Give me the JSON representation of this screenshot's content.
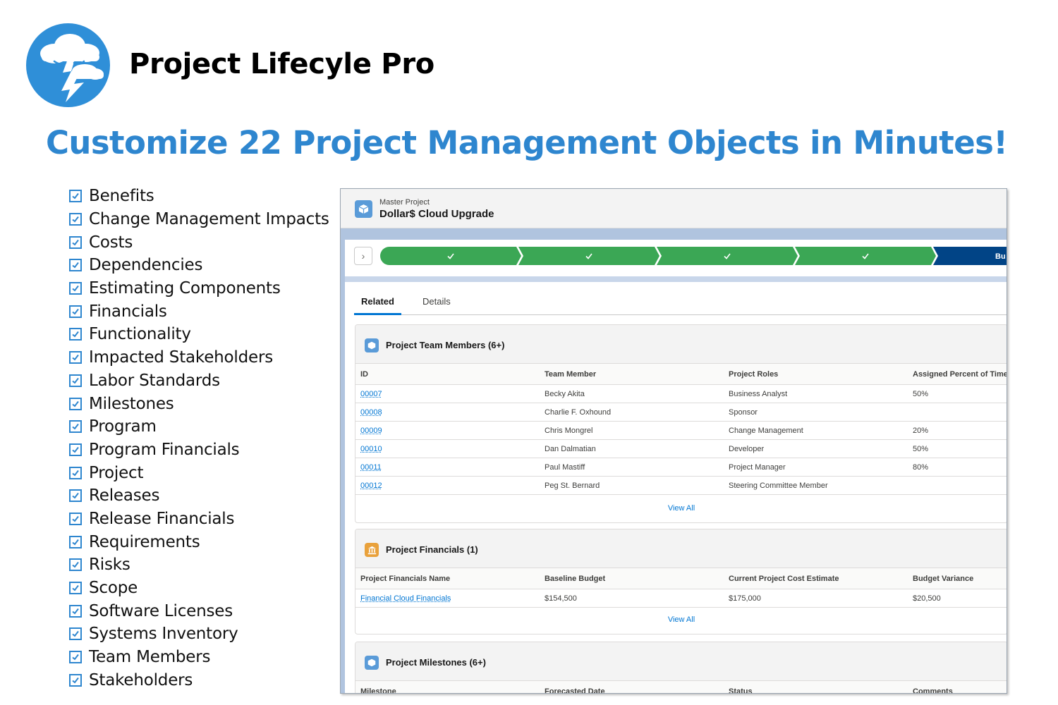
{
  "app": {
    "title": "Project Lifecyle Pro"
  },
  "headline": "Customize 22 Project Management Objects in Minutes!",
  "objects": [
    "Benefits",
    "Change Management Impacts",
    "Costs",
    "Dependencies",
    "Estimating Components",
    "Financials",
    "Functionality",
    "Impacted Stakeholders",
    "Labor Standards",
    "Milestones",
    "Program",
    "Program Financials",
    "Project",
    "Releases",
    "Release Financials",
    "Requirements",
    "Risks",
    "Scope",
    "Software Licenses",
    "Systems Inventory",
    "Team Members",
    "Stakeholders"
  ],
  "record": {
    "type": "Master Project",
    "name": "Dollar$ Cloud Upgrade",
    "path_current_partial": "Bu"
  },
  "tabs": {
    "related": "Related",
    "details": "Details"
  },
  "team_card": {
    "title": "Project Team Members (6+)",
    "columns": [
      "ID",
      "Team Member",
      "Project Roles",
      "Assigned Percent of Time"
    ],
    "rows": [
      [
        "00007",
        "Becky Akita",
        "Business Analyst",
        "50%"
      ],
      [
        "00008",
        "Charlie F. Oxhound",
        "Sponsor",
        ""
      ],
      [
        "00009",
        "Chris Mongrel",
        "Change Management",
        "20%"
      ],
      [
        "00010",
        "Dan Dalmatian",
        "Developer",
        "50%"
      ],
      [
        "00011",
        "Paul Mastiff",
        "Project Manager",
        "80%"
      ],
      [
        "00012",
        "Peg St. Bernard",
        "Steering Committee Member",
        ""
      ]
    ],
    "view_all": "View All"
  },
  "fin_card": {
    "title": "Project Financials (1)",
    "columns": [
      "Project Financials Name",
      "Baseline Budget",
      "Current Project Cost Estimate",
      "Budget Variance"
    ],
    "rows": [
      [
        "Financial Cloud Financials",
        "$154,500",
        "$175,000",
        "$20,500"
      ]
    ],
    "view_all": "View All"
  },
  "mile_card": {
    "title": "Project Milestones (6+)",
    "columns": [
      "Milestone",
      "Forecasted Date",
      "Status",
      "Comments"
    ]
  },
  "colors": {
    "accent": "#2e86cf",
    "path_complete": "#3ba755",
    "path_current": "#014486",
    "link": "#0176d3"
  }
}
